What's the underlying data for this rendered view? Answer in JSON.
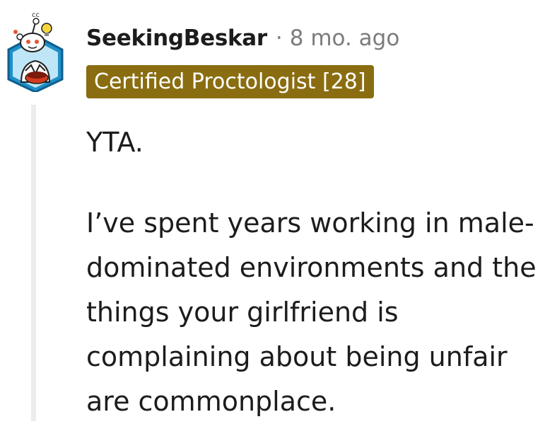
{
  "comment": {
    "author": "SeekingBeskar",
    "separator": "·",
    "timestamp": "8 mo. ago",
    "flair": "Certified Proctologist [28]",
    "flair_color": "#8a6d10",
    "avatar_icon": "snoo-avatar-icon",
    "paragraphs": [
      "YTA.",
      "I’ve spent years working in male-dominated environments and the things your girlfriend is complaining about being unfair are commonplace."
    ]
  }
}
